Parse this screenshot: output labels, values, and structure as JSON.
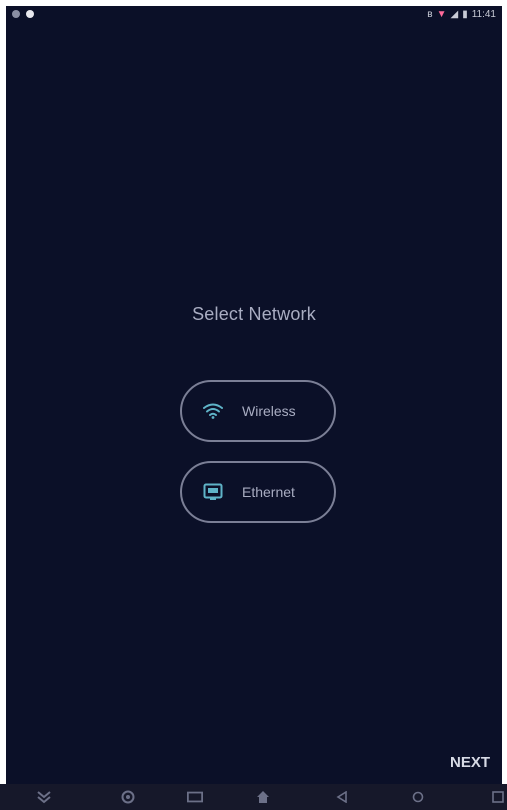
{
  "status_bar": {
    "right_icons": [
      "bluetooth-icon",
      "wifi-icon",
      "signal-icon",
      "battery-icon"
    ],
    "time": "11:41"
  },
  "setup": {
    "title": "Select Network",
    "options": [
      {
        "label": "Wireless",
        "icon": "wifi-icon"
      },
      {
        "label": "Ethernet",
        "icon": "ethernet-icon"
      }
    ],
    "next_label": "NEXT"
  },
  "nav_bar": {
    "buttons": [
      "collapse-icon",
      "screenshot-icon",
      "recent-apps-icon",
      "home-icon",
      "back-icon",
      "circle-icon",
      "overview-icon"
    ]
  },
  "colors": {
    "background": "#0b1028",
    "text": "#a9adc2",
    "outline": "#7b7f96",
    "accent": "#5fb4c8"
  }
}
